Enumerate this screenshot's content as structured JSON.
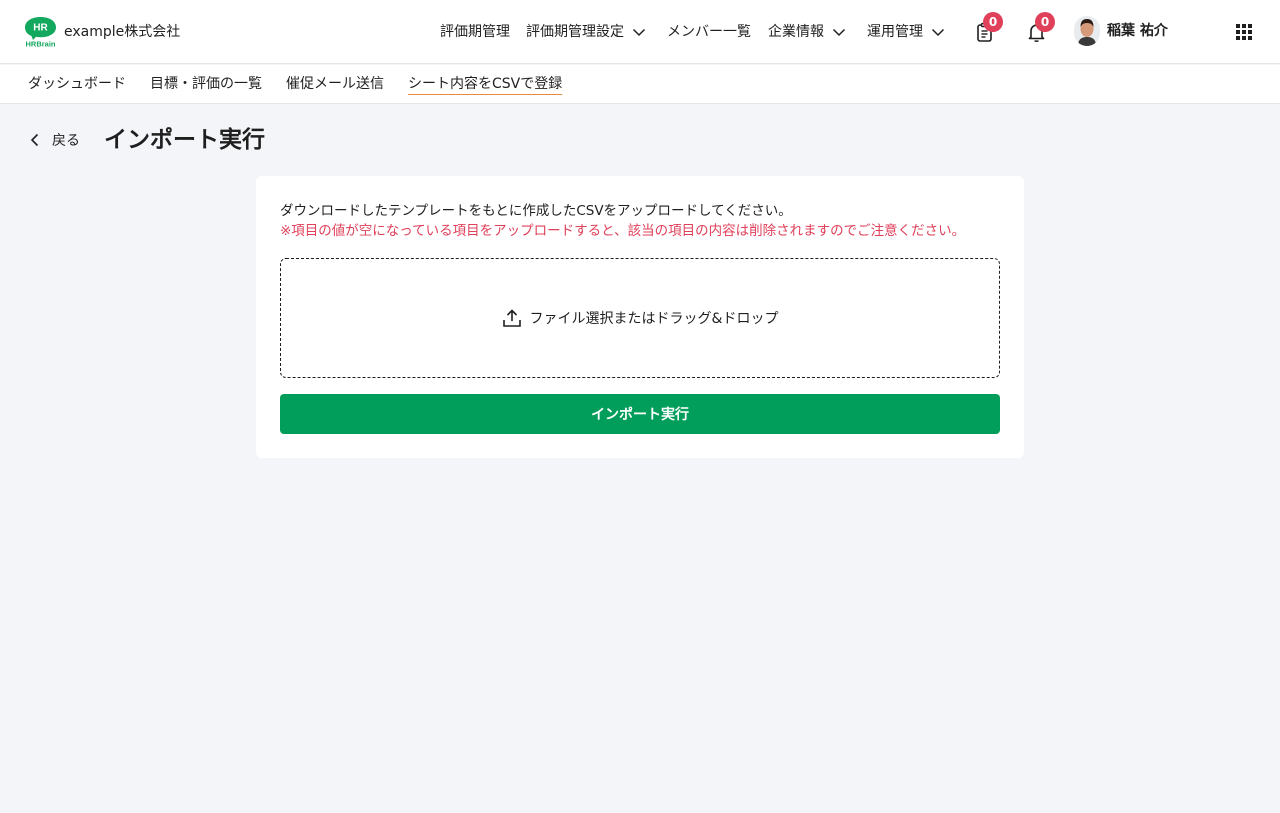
{
  "header": {
    "company": "example株式会社",
    "nav": [
      {
        "label": "評価期管理",
        "has_dropdown": false
      },
      {
        "label": "評価期管理設定",
        "has_dropdown": true
      },
      {
        "label": "メンバー一覧",
        "has_dropdown": false
      },
      {
        "label": "企業情報",
        "has_dropdown": true
      },
      {
        "label": "運用管理",
        "has_dropdown": true
      }
    ],
    "tasks_count": "0",
    "notifications_count": "0",
    "user_name": "稲葉 祐介",
    "icons": [
      "clipboard-icon",
      "bell-icon",
      "apps-grid-icon"
    ]
  },
  "subnav": {
    "items": [
      {
        "label": "ダッシュボード"
      },
      {
        "label": "目標・評価の一覧"
      },
      {
        "label": "催促メール送信"
      },
      {
        "label": "シート内容をCSVで登録",
        "active": true
      }
    ]
  },
  "page": {
    "back_label": "戻る",
    "title": "インポート実行"
  },
  "card": {
    "description": "ダウンロードしたテンプレートをもとに作成したCSVをアップロードしてください。",
    "warning": "※項目の値が空になっている項目をアップロードすると、該当の項目の内容は削除されますのでご注意ください。",
    "dropzone_label": "ファイル選択またはドラッグ&ドロップ",
    "submit_label": "インポート実行"
  },
  "colors": {
    "brand_green": "#009e5a",
    "badge_red": "#e0405a",
    "warning_red": "#e0405a",
    "active_underline": "#e88b3c",
    "page_background": "#f4f5f9"
  }
}
